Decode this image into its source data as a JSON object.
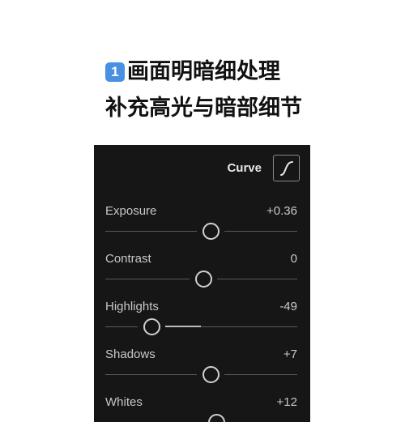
{
  "headline": {
    "badge": "1",
    "line1": "画面明暗细处理",
    "line2": "补充高光与暗部细节"
  },
  "panel": {
    "curve_label": "Curve",
    "curve_icon": "s-curve-icon",
    "sliders": [
      {
        "label": "Exposure",
        "value": "+0.36",
        "position": 0.55
      },
      {
        "label": "Contrast",
        "value": "0",
        "position": 0.51
      },
      {
        "label": "Highlights",
        "value": "-49",
        "position": 0.24
      },
      {
        "label": "Shadows",
        "value": "+7",
        "position": 0.55
      },
      {
        "label": "Whites",
        "value": "+12",
        "position": 0.58
      }
    ]
  },
  "colors": {
    "panel_bg": "#161616",
    "badge_bg": "#4a90e2"
  }
}
